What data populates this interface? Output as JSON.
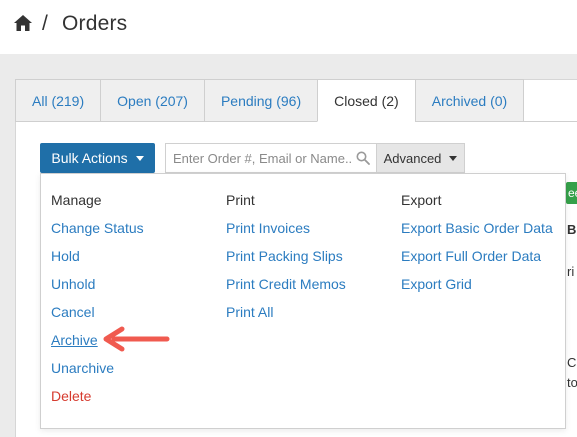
{
  "header": {
    "separator": "/",
    "title": "Orders",
    "home_icon": "home-icon"
  },
  "tabs": [
    {
      "label": "All (219)",
      "active": false
    },
    {
      "label": "Open (207)",
      "active": false
    },
    {
      "label": "Pending (96)",
      "active": false
    },
    {
      "label": "Closed (2)",
      "active": true
    },
    {
      "label": "Archived (0)",
      "active": false
    }
  ],
  "toolbar": {
    "bulk_label": "Bulk Actions",
    "search_placeholder": "Enter Order #, Email or Name...",
    "advanced_label": "Advanced"
  },
  "menu": {
    "manage": {
      "heading": "Manage",
      "items": [
        "Change Status",
        "Hold",
        "Unhold",
        "Cancel",
        "Archive",
        "Unarchive",
        "Delete"
      ]
    },
    "print": {
      "heading": "Print",
      "items": [
        "Print Invoices",
        "Print Packing Slips",
        "Print Credit Memos",
        "Print All"
      ]
    },
    "export": {
      "heading": "Export",
      "items": [
        "Export Basic Order Data",
        "Export Full Order Data",
        "Export Grid"
      ]
    }
  },
  "peek": {
    "badge": "ee",
    "row1": "Bil",
    "row2": "ri",
    "row3": "Ca",
    "row4": "to"
  },
  "colors": {
    "primary": "#1f6fa8",
    "link": "#2b7cc0",
    "danger": "#d63b2f",
    "annotation_arrow": "#f05a4f"
  }
}
